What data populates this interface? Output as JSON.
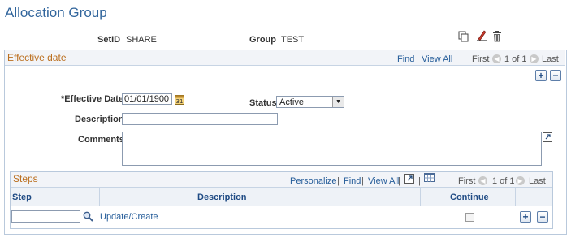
{
  "page": {
    "title": "Allocation Group"
  },
  "keys": {
    "setid_label": "SetID",
    "setid_value": "SHARE",
    "group_label": "Group",
    "group_value": "TEST"
  },
  "toolbar_icons": [
    "copy-icon",
    "edit-icon",
    "trash-icon"
  ],
  "effective": {
    "section_title": "Effective date",
    "find": "Find",
    "sep": "|",
    "view_all": "View All",
    "first": "First",
    "pager": "1 of 1",
    "last": "Last",
    "add": "+",
    "remove": "−",
    "effdate_label": "*Effective Date",
    "effdate_value": "01/01/1900",
    "status_label": "Status",
    "status_value": "Active",
    "description_label": "Description",
    "description_value": "",
    "comments_label": "Comments",
    "comments_value": ""
  },
  "steps": {
    "section_title": "Steps",
    "personalize": "Personalize",
    "find": "Find",
    "view_all": "View All",
    "first": "First",
    "pager": "1 of 1",
    "last": "Last",
    "columns": {
      "step": "Step",
      "description": "Description",
      "continue": "Continue"
    },
    "rows": [
      {
        "step": "",
        "description": "Update/Create",
        "continue": false
      }
    ],
    "add": "+",
    "remove": "−"
  }
}
